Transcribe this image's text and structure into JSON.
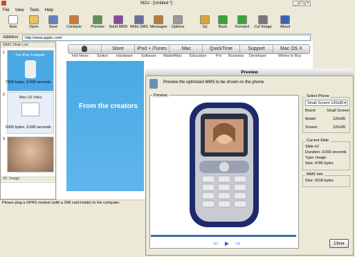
{
  "window": {
    "title": "M2U - [Untitled *]"
  },
  "menu": [
    "File",
    "View",
    "Tools",
    "Help"
  ],
  "toolbar": [
    {
      "label": "New",
      "icon": "new-document-icon",
      "color": "#ffffff"
    },
    {
      "label": "Open",
      "icon": "open-folder-icon",
      "color": "#e8c45a"
    },
    {
      "label": "Save",
      "icon": "save-disk-icon",
      "color": "#6b7fb8"
    },
    {
      "label": "Contacts",
      "icon": "contacts-book-icon",
      "color": "#c87a3c"
    },
    {
      "label": "Preview",
      "icon": "preview-phone-icon",
      "color": "#5f8f5a"
    },
    {
      "label": "Send MMS",
      "icon": "send-mms-icon",
      "color": "#8a4b9c"
    },
    {
      "label": "Write SMS",
      "icon": "write-sms-icon",
      "color": "#6d6d9d"
    },
    {
      "label": "Messages",
      "icon": "messages-icon",
      "color": "#b9793a"
    },
    {
      "label": "Options",
      "icon": "options-icon",
      "color": "#9a9a9a"
    },
    {
      "label": "Up",
      "icon": "up-arrow-icon",
      "color": "#d9a43a"
    },
    {
      "label": "Back",
      "icon": "back-arrow-icon",
      "color": "#3aa33a"
    },
    {
      "label": "Forward",
      "icon": "forward-arrow-icon",
      "color": "#3aa33a"
    },
    {
      "label": "Cut Image",
      "icon": "scissors-icon",
      "color": "#777777"
    },
    {
      "label": "About",
      "icon": "about-icon",
      "color": "#3a62b4"
    }
  ],
  "address": {
    "label": "Address:",
    "value": "http://www.apple.com/"
  },
  "slide_list": {
    "header": "MMS Slide List",
    "slides": [
      {
        "number": "1",
        "size": "7309 bytes, 3.000 seconds",
        "caption": "The iPod. Fantastic.",
        "color": "#4aa9e4"
      },
      {
        "number": "2",
        "size": "6326 bytes, 3.000 seconds",
        "caption": "iMac G5 Video",
        "color": "#e7eef7"
      },
      {
        "number": "3",
        "size": "",
        "caption": "",
        "color": "#c99a7a"
      }
    ],
    "footer": "#2: Image"
  },
  "apple_nav": [
    "Store",
    "iPod + iTunes",
    ".Mac",
    "QuickTime",
    "Support",
    "Mac OS X"
  ],
  "apple_subnav": [
    "Hot News",
    "Switch",
    "Hardware",
    "Software",
    "Made4Mac",
    "Education",
    "Pro",
    "Business",
    "Developer",
    "Where to Buy"
  ],
  "banner": {
    "text": "From the creators"
  },
  "status": "Please plug a GPRS modem (with a SIM card inside) to the computer.",
  "preview": {
    "title": "Preview",
    "instruction": "Preview the optimized MMS to be shown on the phone.",
    "frame_label": "Preview",
    "select_phone_label": "Select Phone",
    "select_value": "Small Screen 120x95",
    "brand_label": "Brand",
    "brand_value": "Small Screen",
    "model_label": "Model",
    "model_value": "120x95",
    "screen_label": "Screen",
    "screen_value": "120x95",
    "current_slide_label": "Current Slide",
    "slide_line": "Slide #2",
    "duration_line": "Duration: 3.000 seconds",
    "type_line": "Type: Image",
    "size_line": "Size: 4780 bytes",
    "mms_info_label": "MMS Info",
    "mms_size_line": "Size: 9218 bytes",
    "close_label": "Close",
    "progress": 1.0
  }
}
